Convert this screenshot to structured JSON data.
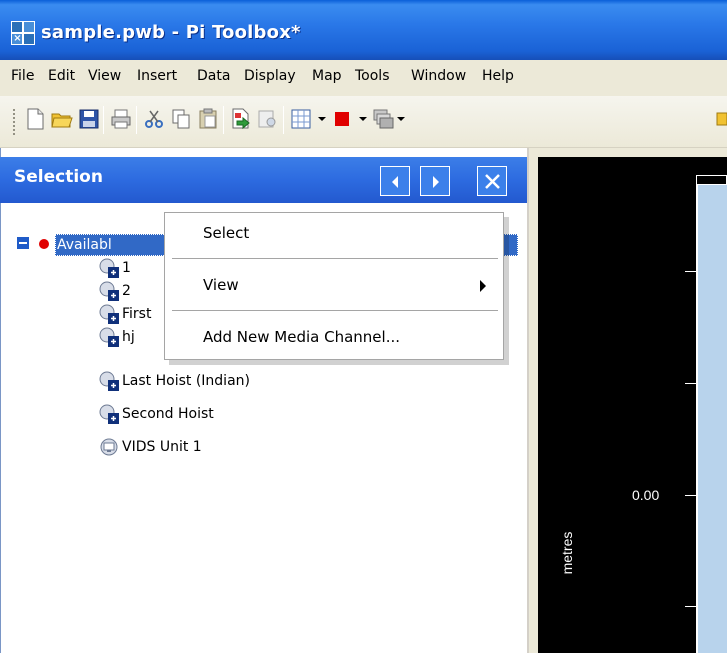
{
  "window": {
    "title": "sample.pwb - Pi Toolbox*"
  },
  "menubar": {
    "items": [
      "File",
      "Edit",
      "View",
      "Insert",
      "Data",
      "Display",
      "Map",
      "Tools",
      "Window",
      "Help"
    ]
  },
  "toolbar": {
    "buttons": [
      "new-document-icon",
      "open-folder-icon",
      "save-icon",
      "print-icon",
      "cut-icon",
      "copy-icon",
      "paste-icon",
      "export-icon",
      "search-icon",
      "grid-icon",
      "red-square-icon",
      "layers-icon"
    ]
  },
  "selection_panel": {
    "title": "Selection",
    "tree": {
      "root_label": "Availabl",
      "children": [
        "1",
        "2",
        "First",
        "hj",
        "Last Hoist (Indian)",
        "Second Hoist",
        "VIDS Unit 1"
      ]
    }
  },
  "context_menu": {
    "items": [
      "Select",
      "View",
      "Add New Media Channel..."
    ]
  },
  "chart": {
    "y_tick_value": "0.00",
    "y_unit": "metres",
    "plot_fill": "#b8d3ec"
  },
  "colors": {
    "title_bar": "#1a62d6",
    "panel_header": "#2d6be0",
    "selection_highlight": "#3169c6",
    "record_dot": "#e00000"
  }
}
